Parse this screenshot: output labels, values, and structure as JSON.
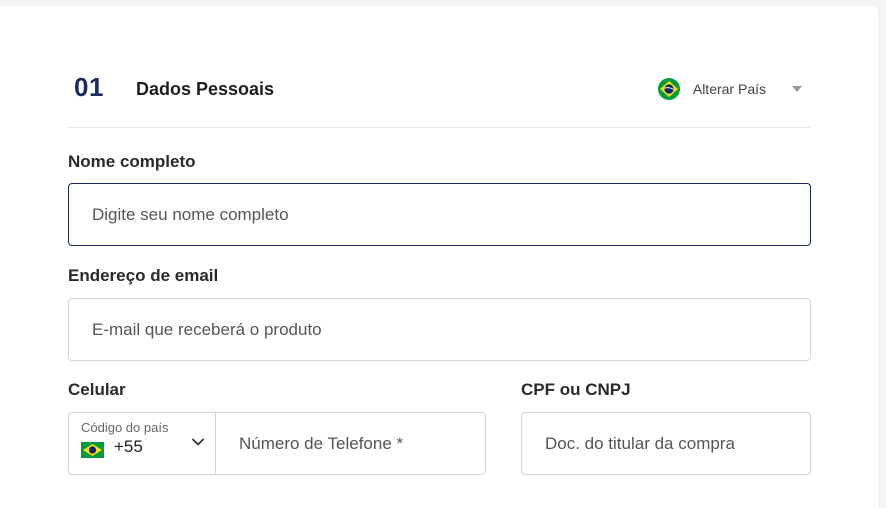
{
  "header": {
    "step_number": "01",
    "title": "Dados Pessoais",
    "country_switch": {
      "label": "Alterar País",
      "flag_icon": "brazil-flag-icon",
      "caret_icon": "caret-down-icon"
    }
  },
  "form": {
    "name": {
      "label": "Nome completo",
      "placeholder": "Digite seu nome completo",
      "value": ""
    },
    "email": {
      "label": "Endereço de email",
      "placeholder": "E-mail que receberá o produto",
      "value": ""
    },
    "phone": {
      "label": "Celular",
      "country_code_label": "Código do país",
      "country_code": "+55",
      "placeholder": "Número de Telefone *",
      "value": ""
    },
    "document": {
      "label": "CPF ou CNPJ",
      "placeholder": "Doc. do titular da compra",
      "value": ""
    }
  },
  "colors": {
    "accent": "#1b2a5c",
    "flag_green": "#009c3b",
    "flag_yellow": "#ffdf00",
    "flag_blue": "#002776"
  }
}
